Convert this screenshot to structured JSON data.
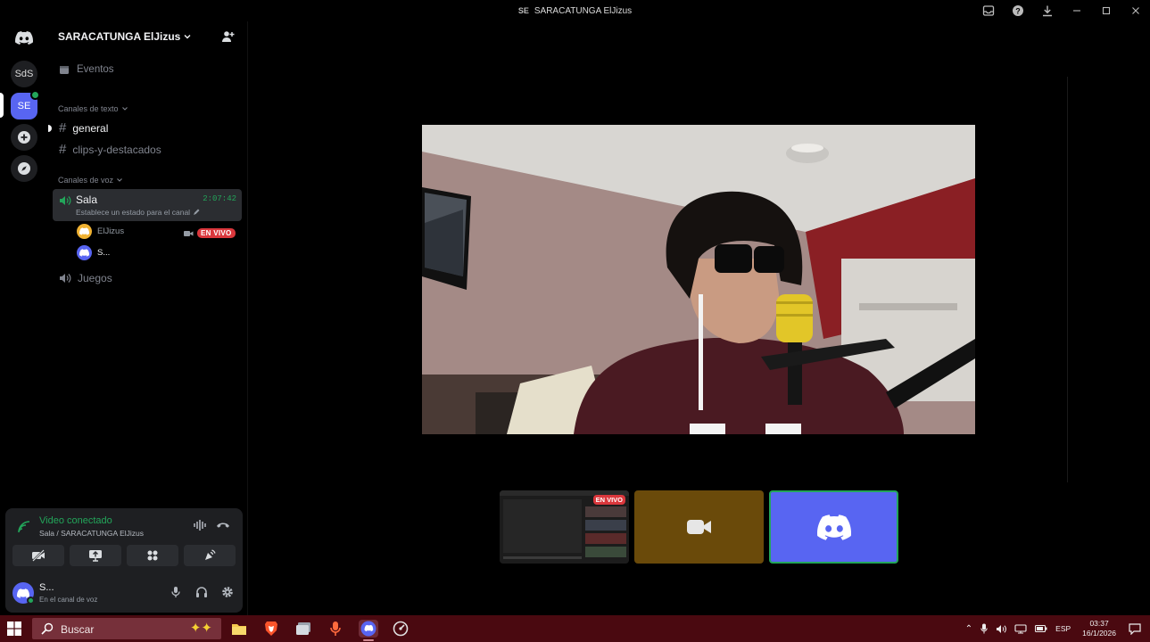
{
  "window": {
    "title": "SARACATUNGA ElJizus",
    "title_icon": "SE",
    "controls": [
      "inbox-icon",
      "help-icon",
      "download-icon",
      "minimize",
      "maximize",
      "close"
    ]
  },
  "guilds": [
    {
      "name": "discord-home",
      "label": ""
    },
    {
      "name": "server-sds",
      "label": "SdS"
    },
    {
      "name": "server-se",
      "label": "SE",
      "active": true
    },
    {
      "name": "add-server",
      "label": ""
    },
    {
      "name": "discover",
      "label": ""
    }
  ],
  "sidebar": {
    "server_name": "SARACATUNGA ElJizus",
    "events_label": "Eventos",
    "text_category": "Canales de texto",
    "text_channels": [
      {
        "name": "general",
        "unread": true
      },
      {
        "name": "clips-y-destacados",
        "unread": false
      }
    ],
    "voice_category": "Canales de voz",
    "voice_channels": [
      {
        "name": "Sala",
        "active": true,
        "elapsed": "2:07:42",
        "status_placeholder": "Establece un estado para el canal"
      },
      {
        "name": "Juegos",
        "active": false
      }
    ],
    "members": [
      {
        "name": "ElJizus",
        "live_label": "EN VIVO",
        "avatar_color": "#f0b232"
      },
      {
        "name": "S...",
        "avatar_color": "#5865f2"
      }
    ]
  },
  "voice_panel": {
    "title": "Video conectado",
    "subtitle": "Sala / SARACATUNGA ElJizus",
    "buttons": [
      "camera-off",
      "screen-share",
      "activities",
      "soundboard"
    ]
  },
  "user": {
    "name": "S...",
    "status": "En el canal de voz"
  },
  "stage": {
    "thumbs": [
      {
        "kind": "stream-preview",
        "live_label": "EN VIVO"
      },
      {
        "kind": "camera",
        "color": "#6a4a0a"
      },
      {
        "kind": "discord-user",
        "color": "#5865f2"
      }
    ]
  },
  "taskbar": {
    "search_placeholder": "Buscar",
    "apps": [
      "file-explorer",
      "brave-browser",
      "app-window",
      "microphone-app",
      "discord",
      "speedometer-app"
    ],
    "lang": "ESP",
    "time": "03:37",
    "date": "16/1/2026"
  }
}
